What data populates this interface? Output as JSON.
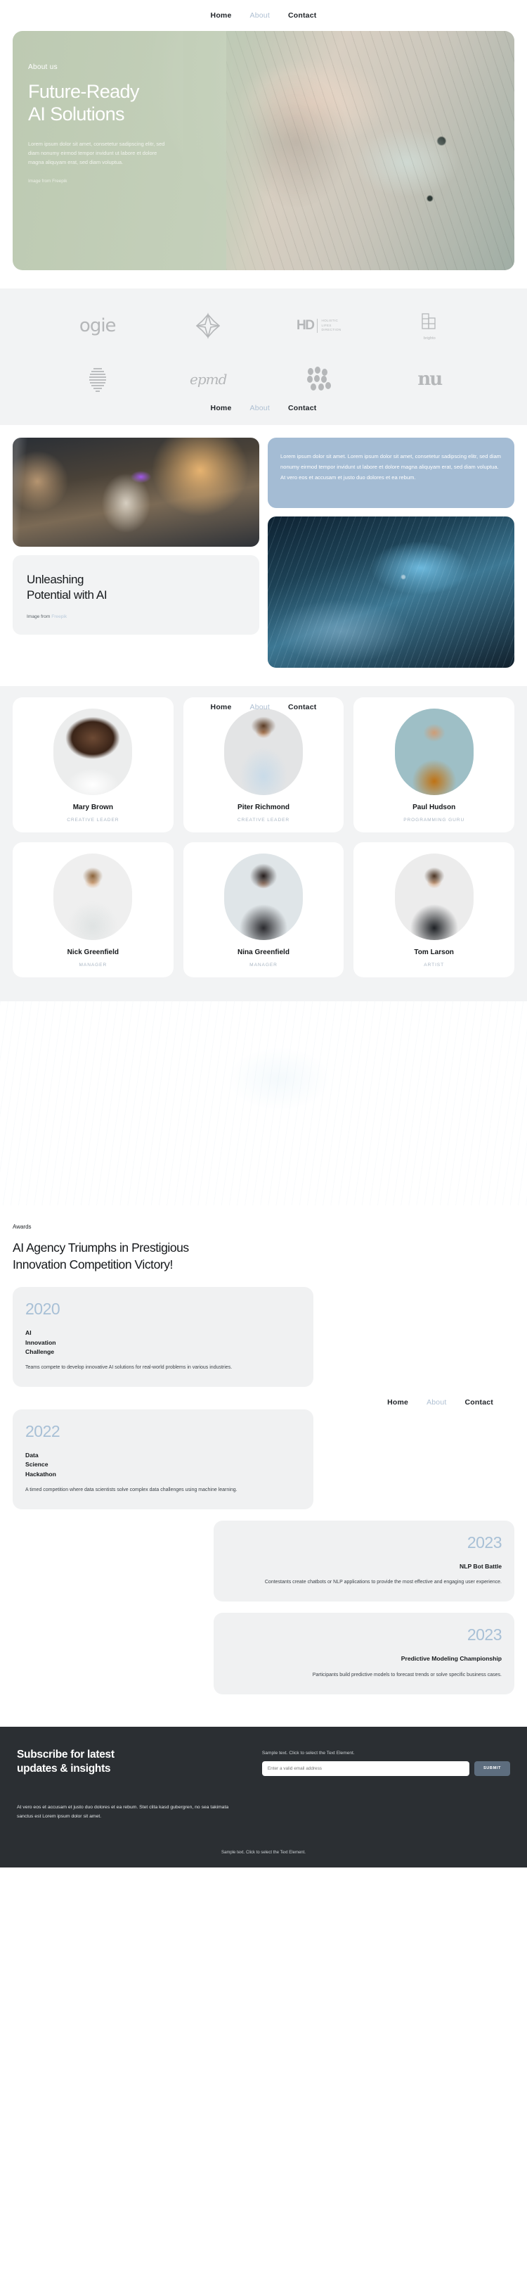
{
  "nav": {
    "items": [
      {
        "label": "Home",
        "state": "active"
      },
      {
        "label": "About",
        "state": "muted"
      },
      {
        "label": "Contact",
        "state": "active"
      }
    ]
  },
  "hero": {
    "eyebrow": "About us",
    "title_line1": "Future-Ready",
    "title_line2": "AI Solutions",
    "paragraph": "Lorem ipsum dolor sit amet, consetetur sadipscing elitr, sed diam nonumy eirmod tempor invidunt ut labore et dolore magna aliquyam erat, sed diam voluptua.",
    "credit": "Image from Freepik",
    "bg_color": "#c3cfb9"
  },
  "logos": {
    "items": [
      {
        "name": "ogie",
        "type": "wordmark"
      },
      {
        "name": "flower-mark",
        "type": "symbol"
      },
      {
        "name": "HD",
        "sub": "HOLISTIC\nLIFES\nDIRECTION",
        "type": "lockup"
      },
      {
        "name": "brighto",
        "type": "stack-symbol"
      },
      {
        "name": "striped-sphere",
        "type": "symbol"
      },
      {
        "name": "epmd",
        "type": "wordmark"
      },
      {
        "name": "dots-cluster",
        "type": "symbol"
      },
      {
        "name": "nu",
        "type": "wordmark"
      }
    ],
    "color": "#b5b7b9",
    "bg_color": "#f2f3f4"
  },
  "showcase": {
    "paragraph": "Lorem ipsum dolor sit amet. Lorem ipsum dolor sit amet, consetetur sadipscing elitr, sed diam nonumy eirmod tempor invidunt ut labore et dolore magna aliquyam erat, sed diam voluptua. At vero eos et accusam et justo duo dolores et ea rebum.",
    "paragraph_bg": "#a4bcd4",
    "heading_line1": "Unleashing",
    "heading_line2": "Potential with AI",
    "credit_prefix": "Image from ",
    "credit_link": "Freepik",
    "image_left_alt": "robot-in-corridor",
    "image_right_alt": "blue-android-head"
  },
  "team": {
    "members": [
      {
        "name": "Mary Brown",
        "role": "CREATIVE LEADER",
        "avatar": "woman-curly-hair-glasses"
      },
      {
        "name": "Piter Richmond",
        "role": "CREATIVE LEADER",
        "avatar": "man-light-blue-shirt"
      },
      {
        "name": "Paul Hudson",
        "role": "PROGRAMMING GURU",
        "avatar": "man-orange-shirt"
      },
      {
        "name": "Nick Greenfield",
        "role": "MANAGER",
        "avatar": "man-grey-tshirt"
      },
      {
        "name": "Nina Greenfield",
        "role": "MANAGER",
        "avatar": "woman-dark-hair-arms-crossed"
      },
      {
        "name": "Tom Larson",
        "role": "ARTIST",
        "avatar": "man-black-tshirt"
      }
    ],
    "role_color": "#a9b6c3",
    "bg_color": "#f2f3f4"
  },
  "banner": {
    "alt": "android-head-dark-banner"
  },
  "awards": {
    "eyebrow": "Awards",
    "heading_line1": "AI Agency Triumphs in Prestigious",
    "heading_line2": "Innovation Competition Victory!",
    "year_color": "#a8c0d6",
    "cards": [
      {
        "year": "2020",
        "name": "AI\nInnovation\nChallenge",
        "description": "Teams compete to develop innovative AI solutions for real-world problems in various industries.",
        "align": "left"
      },
      {
        "year": "2022",
        "name": "Data\nScience\nHackathon",
        "description": "A timed competition where data scientists solve complex data challenges using machine learning.",
        "align": "left"
      },
      {
        "year": "2023",
        "name": "NLP Bot Battle",
        "description": "Contestants create chatbots or NLP applications to provide the most effective and engaging user experience.",
        "align": "right"
      },
      {
        "year": "2023",
        "name": "Predictive Modeling Championship",
        "description": "Participants build predictive models to forecast trends or solve specific business cases.",
        "align": "right"
      }
    ]
  },
  "footer": {
    "heading_line1": "Subscribe for latest",
    "heading_line2": "updates & insights",
    "sample_note": "Sample text. Click to select the Text Element.",
    "email_placeholder": "Enter a valid email address",
    "submit_label": "SUBMIT",
    "body": "At vero eos et accusam et justo duo dolores et ea rebum. Stet clita kasd gubergren, no sea takimata sanctus est Lorem ipsum dolor sit amet.",
    "bottom_note": "Sample text. Click to select the Text Element.",
    "bg_color": "#2b2f33",
    "button_color": "#5d6d7e"
  }
}
